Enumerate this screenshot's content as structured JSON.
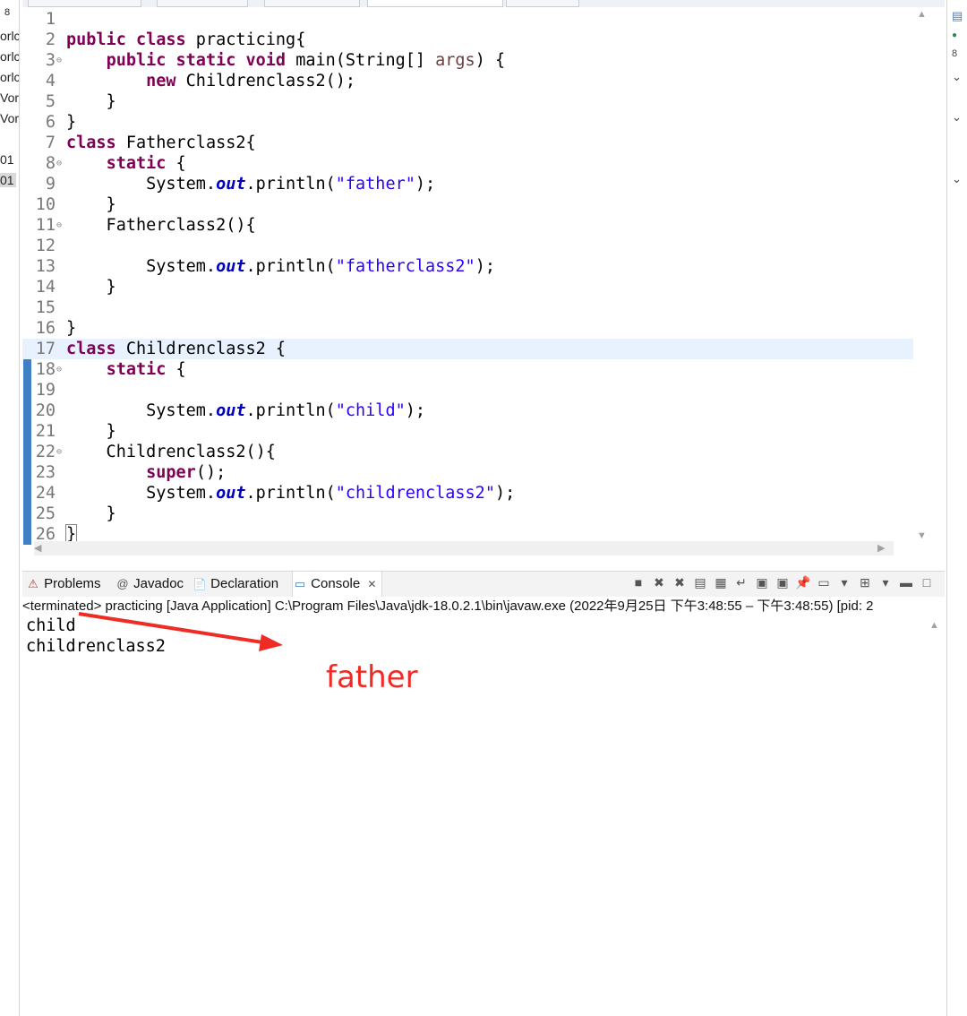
{
  "left_strip": {
    "items": [
      "8",
      "orlc",
      "orlc",
      "orlc",
      "Vor",
      "Vor",
      "01",
      "01"
    ]
  },
  "editor": {
    "lines": [
      {
        "n": "1",
        "fold": "",
        "html": ""
      },
      {
        "n": "2",
        "fold": "",
        "html": "<span class='kw'>public</span> <span class='kw'>class</span> practicing{"
      },
      {
        "n": "3",
        "fold": "⊖",
        "html": "    <span class='kw'>public</span> <span class='kw'>static</span> <span class='kw'>void</span> main(String[] <span class='prm'>args</span>) {"
      },
      {
        "n": "4",
        "fold": "",
        "html": "        <span class='kw'>new</span> Childrenclass2();"
      },
      {
        "n": "5",
        "fold": "",
        "html": "    }"
      },
      {
        "n": "6",
        "fold": "",
        "html": "}"
      },
      {
        "n": "7",
        "fold": "",
        "html": "<span class='kw'>class</span> Fatherclass2{"
      },
      {
        "n": "8",
        "fold": "⊖",
        "html": "    <span class='kw'>static</span> {"
      },
      {
        "n": "9",
        "fold": "",
        "html": "        System.<span class='fld'>out</span>.println(<span class='str'>\"father\"</span>);"
      },
      {
        "n": "10",
        "fold": "",
        "html": "    }"
      },
      {
        "n": "11",
        "fold": "⊖",
        "html": "    Fatherclass2(){"
      },
      {
        "n": "12",
        "fold": "",
        "html": ""
      },
      {
        "n": "13",
        "fold": "",
        "html": "        System.<span class='fld'>out</span>.println(<span class='str'>\"fatherclass2\"</span>);"
      },
      {
        "n": "14",
        "fold": "",
        "html": "    }"
      },
      {
        "n": "15",
        "fold": "",
        "html": ""
      },
      {
        "n": "16",
        "fold": "",
        "html": "}"
      },
      {
        "n": "17",
        "fold": "",
        "html": "<span class='kw'>class</span> Childrenclass2 {",
        "highlight": true
      },
      {
        "n": "18",
        "fold": "⊖",
        "html": "    <span class='kw'>static</span> {"
      },
      {
        "n": "19",
        "fold": "",
        "html": ""
      },
      {
        "n": "20",
        "fold": "",
        "html": "        System.<span class='fld'>out</span>.println(<span class='str'>\"child\"</span>);"
      },
      {
        "n": "21",
        "fold": "",
        "html": "    }"
      },
      {
        "n": "22",
        "fold": "⊖",
        "html": "    Childrenclass2(){"
      },
      {
        "n": "23",
        "fold": "",
        "html": "        <span class='kw'>super</span>();"
      },
      {
        "n": "24",
        "fold": "",
        "html": "        System.<span class='fld'>out</span>.println(<span class='str'>\"childrenclass2\"</span>);"
      },
      {
        "n": "25",
        "fold": "",
        "html": "    }"
      },
      {
        "n": "26",
        "fold": "",
        "html": "<span class='caret-box'>}</span>"
      }
    ],
    "change_marker_lines": [
      17,
      26
    ]
  },
  "views": {
    "tabs": [
      {
        "label": "Problems",
        "icon": "problems-icon",
        "glyph": "⚠"
      },
      {
        "label": "Javadoc",
        "icon": "javadoc-icon",
        "glyph": "@"
      },
      {
        "label": "Declaration",
        "icon": "declaration-icon",
        "glyph": "📄"
      },
      {
        "label": "Console",
        "icon": "console-icon",
        "glyph": "▭",
        "active": true
      }
    ],
    "close_glyph": "✕",
    "toolbar_icons": [
      {
        "name": "terminate-icon",
        "glyph": "■"
      },
      {
        "name": "remove-launch-icon",
        "glyph": "✖"
      },
      {
        "name": "remove-all-terminated-icon",
        "glyph": "✖"
      },
      {
        "name": "clear-console-icon",
        "glyph": "▤"
      },
      {
        "name": "scroll-lock-icon",
        "glyph": "▦"
      },
      {
        "name": "word-wrap-icon",
        "glyph": "↵"
      },
      {
        "name": "show-on-stdout-icon",
        "glyph": "▣"
      },
      {
        "name": "show-on-stderr-icon",
        "glyph": "▣"
      },
      {
        "name": "pin-console-icon",
        "glyph": "📌"
      },
      {
        "name": "display-console-icon",
        "glyph": "▭"
      },
      {
        "name": "display-console-dropdown-icon",
        "glyph": "▾"
      },
      {
        "name": "open-console-icon",
        "glyph": "⊞"
      },
      {
        "name": "open-console-dropdown-icon",
        "glyph": "▾"
      },
      {
        "name": "minimize-icon",
        "glyph": "▬"
      },
      {
        "name": "maximize-icon",
        "glyph": "□"
      }
    ]
  },
  "console": {
    "status": "<terminated> practicing [Java Application] C:\\Program Files\\Java\\jdk-18.0.2.1\\bin\\javaw.exe  (2022年9月25日 下午3:48:55 – 下午3:48:55) [pid: 2",
    "output": [
      "child",
      "childrenclass2"
    ]
  },
  "annotation": {
    "text": "father",
    "color": "#ee2b24"
  },
  "colors": {
    "keyword": "#7f0055",
    "string": "#2a00ff",
    "field": "#0000c0",
    "highlight": "#e8f2fe",
    "change_marker": "#3f7fc4"
  }
}
